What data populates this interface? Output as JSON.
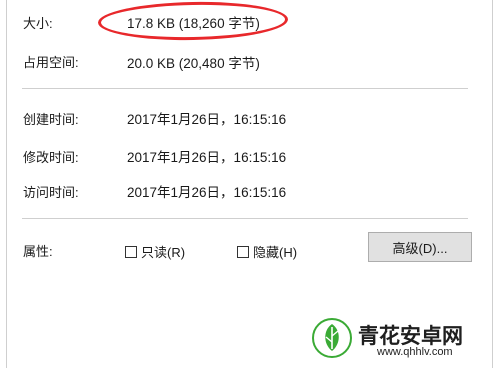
{
  "fields": {
    "size_label": "大小:",
    "size_value": "17.8 KB (18,260 字节)",
    "disk_label": "占用空间:",
    "disk_value": "20.0 KB (20,480 字节)",
    "created_label": "创建时间:",
    "created_value": "2017年1月26日，16:15:16",
    "modified_label": "修改时间:",
    "modified_value": "2017年1月26日，16:15:16",
    "accessed_label": "访问时间:",
    "accessed_value": "2017年1月26日，16:15:16"
  },
  "attributes": {
    "label": "属性:",
    "readonly": {
      "label": "只读(R)",
      "checked": false
    },
    "hidden": {
      "label": "隐藏(H)",
      "checked": false
    },
    "advanced_button": "高级(D)..."
  },
  "annotation": {
    "color": "#e8282b"
  },
  "watermark": {
    "title": "青花安卓网",
    "url": "www.qhhlv.com",
    "logo_icon": "green-leaf-logo",
    "logo_color": "#3aaa35"
  }
}
